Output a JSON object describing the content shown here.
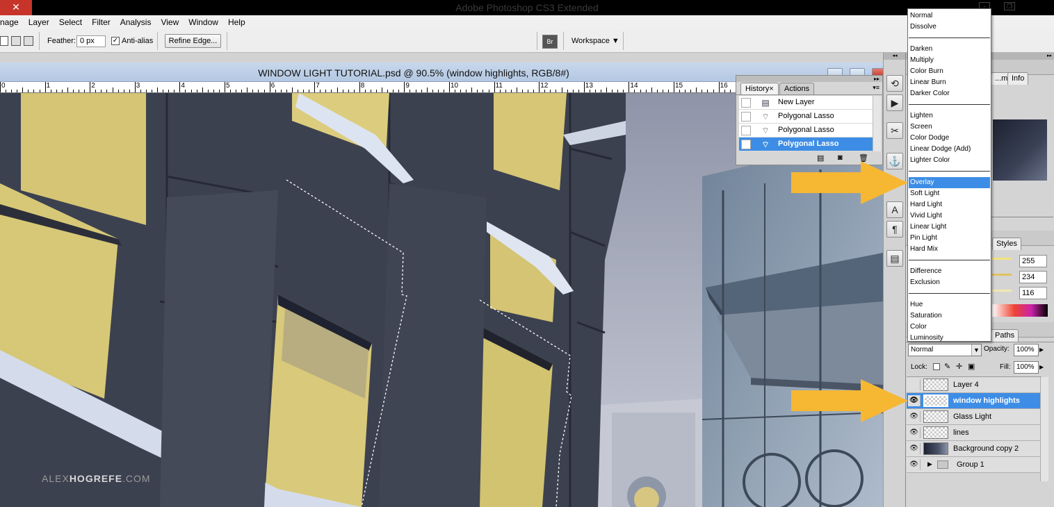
{
  "app": {
    "window_title": "Adobe Photoshop CS3 Extended",
    "window_controls": [
      "-",
      "❐",
      "✕"
    ]
  },
  "menubar": [
    "nage",
    "Layer",
    "Select",
    "Filter",
    "Analysis",
    "View",
    "Window",
    "Help"
  ],
  "options_bar": {
    "feather_label": "Feather:",
    "feather_value": "0 px",
    "antialias_label": "Anti-alias",
    "antialias_checked": true,
    "refine_edge_button": "Refine Edge...",
    "workspace_label": "Workspace"
  },
  "document": {
    "title": "WINDOW LIGHT TUTORIAL.psd @ 90.5% (window highlights, RGB/8#)",
    "ruler_numbers": [
      "0",
      "1",
      "2",
      "3",
      "4",
      "5",
      "6",
      "7",
      "8",
      "9",
      "10",
      "11",
      "12",
      "13",
      "14",
      "15",
      "16"
    ],
    "watermark_light": "ALEX",
    "watermark_bold": "HOGREFE",
    "watermark_end": ".COM"
  },
  "history_panel": {
    "tabs": [
      "History",
      "Actions"
    ],
    "tab_close": "×",
    "items": [
      {
        "label": "New Layer",
        "icon": "new-layer-icon",
        "selected": false
      },
      {
        "label": "Polygonal Lasso",
        "icon": "polygonal-lasso-icon",
        "selected": false
      },
      {
        "label": "Polygonal Lasso",
        "icon": "polygonal-lasso-icon",
        "selected": false
      },
      {
        "label": "Polygonal Lasso",
        "icon": "polygonal-lasso-icon",
        "selected": true
      }
    ]
  },
  "tool_strip": {
    "icons": [
      "history-brush-icon",
      "play-actions-icon",
      "tools-icon",
      "clone-source-icon",
      "character-icon",
      "paragraph-icon",
      "layer-comps-icon"
    ],
    "glyphs": [
      "⟲",
      "▶",
      "✂",
      "⚓",
      "A",
      "¶",
      "▤"
    ]
  },
  "right_panels": {
    "navigator_tabs": [
      "...m",
      "Info"
    ],
    "styles_tab": "Styles",
    "color_values": [
      "255",
      "234",
      "116"
    ],
    "paths_tab": "Paths"
  },
  "blend_modes": {
    "groups": [
      [
        "Normal",
        "Dissolve"
      ],
      [
        "Darken",
        "Multiply",
        "Color Burn",
        "Linear Burn",
        "Darker Color"
      ],
      [
        "Lighten",
        "Screen",
        "Color Dodge",
        "Linear Dodge (Add)",
        "Lighter Color"
      ],
      [
        "Overlay",
        "Soft Light",
        "Hard Light",
        "Vivid Light",
        "Linear Light",
        "Pin Light",
        "Hard Mix"
      ],
      [
        "Difference",
        "Exclusion"
      ],
      [
        "Hue",
        "Saturation",
        "Color",
        "Luminosity"
      ]
    ],
    "selected": "Overlay"
  },
  "layers_panel": {
    "blend_value": "Normal",
    "opacity_label": "Opacity:",
    "opacity_value": "100%",
    "lock_label": "Lock:",
    "fill_label": "Fill:",
    "fill_value": "100%",
    "layers": [
      {
        "name": "Layer 4",
        "visible": false,
        "selected": false,
        "type": "layer"
      },
      {
        "name": "window highlights",
        "visible": true,
        "selected": true,
        "type": "layer"
      },
      {
        "name": "Glass Light",
        "visible": true,
        "selected": false,
        "type": "layer"
      },
      {
        "name": "lines",
        "visible": true,
        "selected": false,
        "type": "layer"
      },
      {
        "name": "Background copy 2",
        "visible": true,
        "selected": false,
        "type": "photo"
      },
      {
        "name": "Group 1",
        "visible": true,
        "selected": false,
        "type": "group"
      }
    ]
  },
  "colors": {
    "selection_blue": "#3d8de6",
    "arrow_orange": "#f6b733",
    "window_yellow": "#d8c978"
  }
}
